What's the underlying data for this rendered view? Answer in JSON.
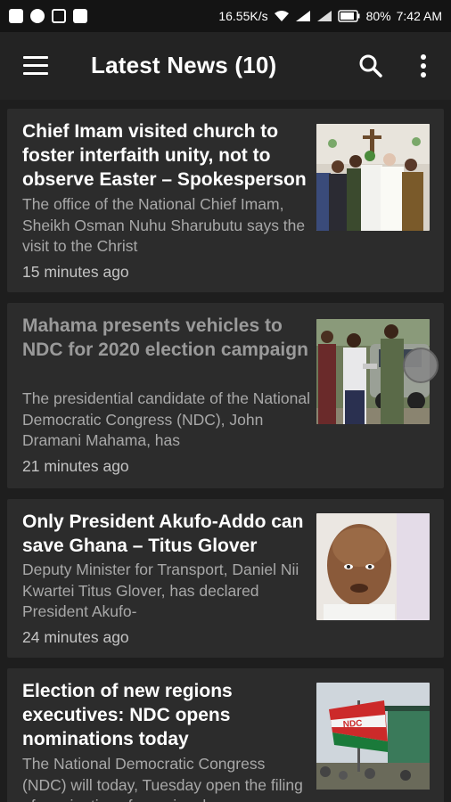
{
  "status_bar": {
    "speed": "16.55K/s",
    "battery": "80%",
    "time": "7:42 AM"
  },
  "app_bar": {
    "title": "Latest News (10)",
    "menu_icon": "hamburger-menu-icon",
    "search_icon": "search-icon",
    "more_icon": "more-vert-icon"
  },
  "articles": [
    {
      "headline": "Chief Imam visited church to foster interfaith unity, not to observe Easter – Spokesperson",
      "excerpt": "The office of the National Chief Imam, Sheikh Osman Nuhu Sharubutu says the visit to the Christ",
      "time": "15 minutes ago",
      "read": false
    },
    {
      "headline": "Mahama presents vehicles to NDC for 2020 election campaign",
      "excerpt": "The presidential candidate of the National Democratic Congress (NDC), John Dramani Mahama, has",
      "time": "21 minutes ago",
      "read": true
    },
    {
      "headline": "Only President Akufo-Addo can save Ghana – Titus Glover",
      "excerpt": "Deputy Minister for Transport, Daniel Nii Kwartei Titus Glover, has declared President Akufo-",
      "time": "24 minutes ago",
      "read": false
    },
    {
      "headline": "Election of new regions executives: NDC opens nominations today",
      "excerpt": "The National Democratic Congress (NDC) will today, Tuesday open the filing of nominations for regional",
      "time": "",
      "read": false
    }
  ],
  "thumbnail_flag_text": "NDC"
}
